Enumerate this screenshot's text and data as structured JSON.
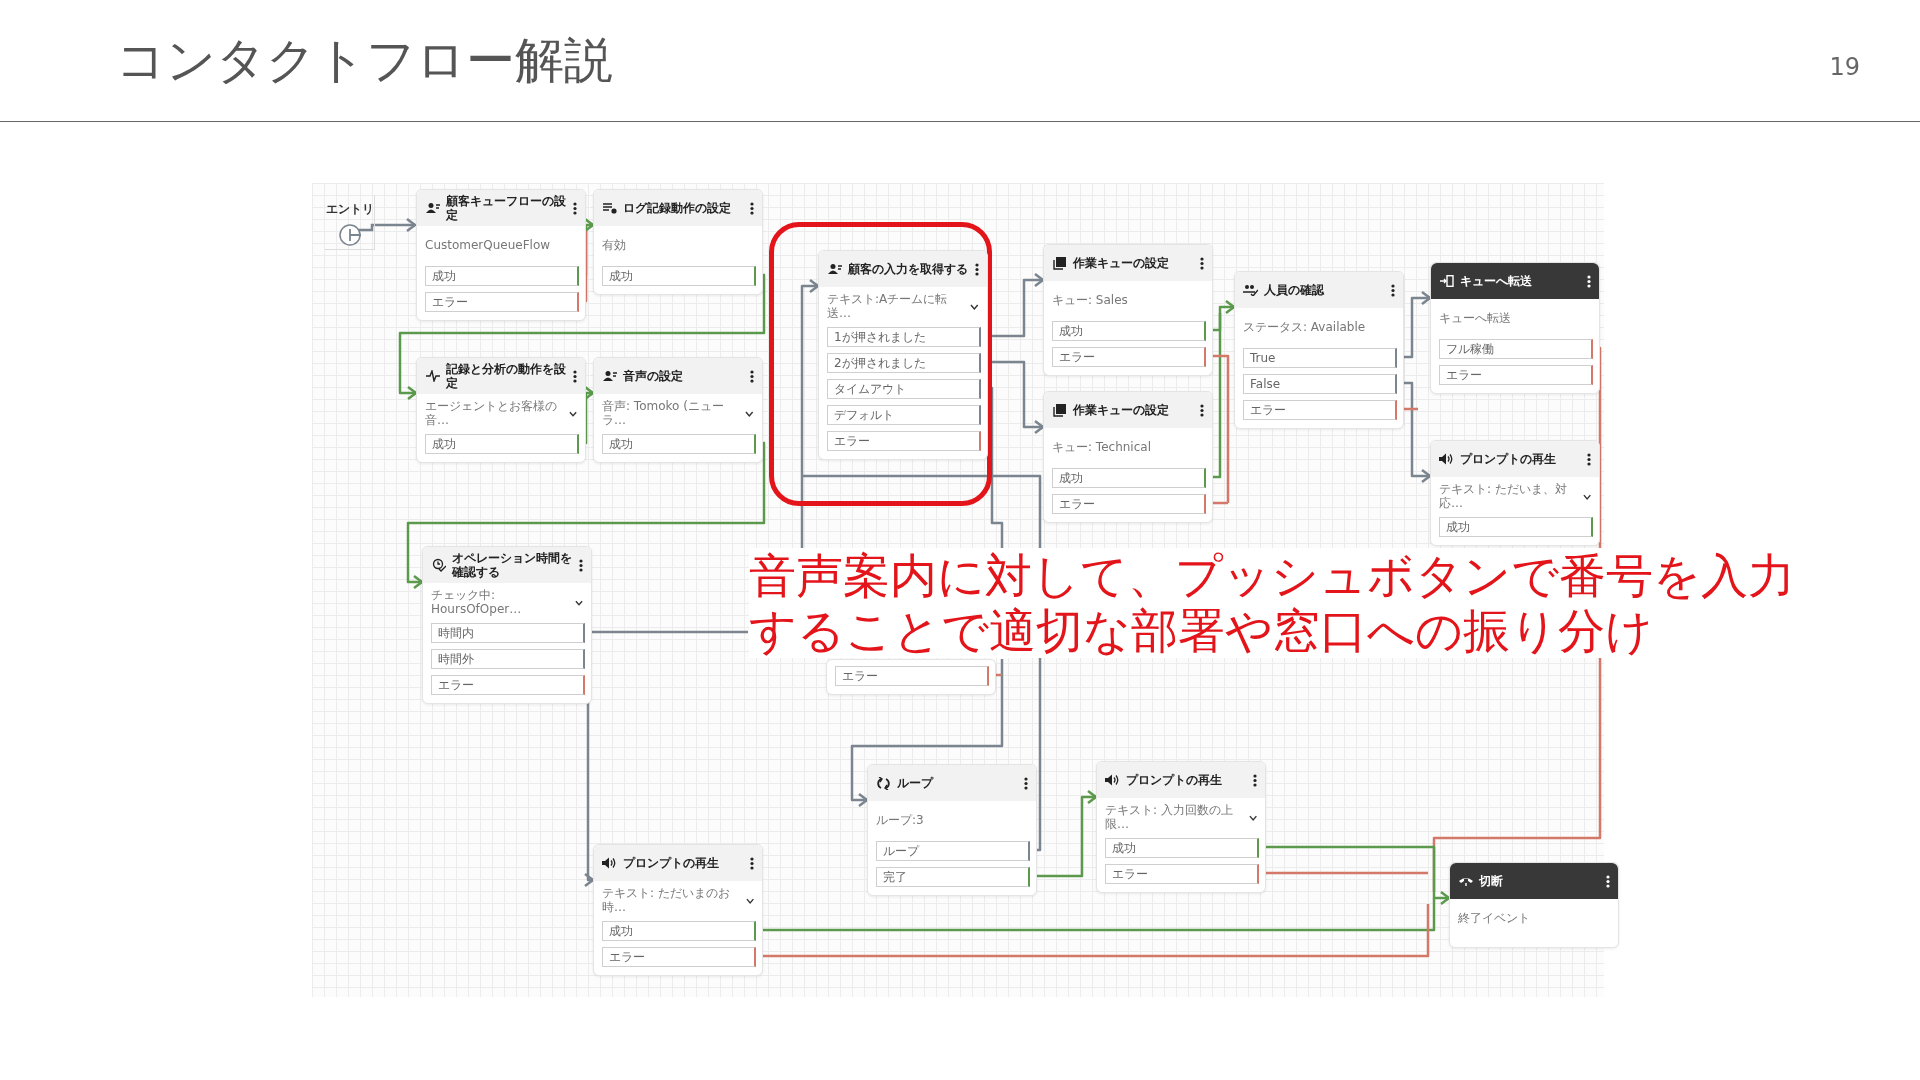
{
  "slide": {
    "title": "コンタクトフロー解説",
    "page_number": "19"
  },
  "flow": {
    "entry": {
      "label": "エントリ"
    },
    "blocks": [
      {
        "title": "顧客キューフローの設定",
        "kind": "action",
        "detail": "CustomerQueueFlow",
        "dropdown": false,
        "ports": [
          {
            "label": "成功",
            "kind": "success"
          },
          {
            "label": "エラー",
            "kind": "error"
          }
        ]
      },
      {
        "title": "ログ記録動作の設定",
        "kind": "action",
        "detail": "有効",
        "dropdown": false,
        "ports": [
          {
            "label": "成功",
            "kind": "success"
          }
        ]
      },
      {
        "title": "記録と分析の動作を設定",
        "kind": "action",
        "detail": "エージェントとお客様の音…",
        "dropdown": true,
        "ports": [
          {
            "label": "成功",
            "kind": "success"
          }
        ]
      },
      {
        "title": "音声の設定",
        "kind": "action",
        "detail": "音声: Tomoko (ニューラ…",
        "dropdown": true,
        "ports": [
          {
            "label": "成功",
            "kind": "success"
          }
        ]
      },
      {
        "title": "顧客の入力を取得する",
        "kind": "action",
        "detail": "テキスト:Aチームに転送…",
        "dropdown": true,
        "ports": [
          {
            "label": "1が押されました",
            "kind": "branch"
          },
          {
            "label": "2が押されました",
            "kind": "branch"
          },
          {
            "label": "タイムアウト",
            "kind": "branch"
          },
          {
            "label": "デフォルト",
            "kind": "branch"
          },
          {
            "label": "エラー",
            "kind": "error"
          }
        ]
      },
      {
        "title": "作業キューの設定",
        "kind": "action",
        "detail": "キュー: Sales",
        "dropdown": false,
        "ports": [
          {
            "label": "成功",
            "kind": "success"
          },
          {
            "label": "エラー",
            "kind": "error"
          }
        ]
      },
      {
        "title": "作業キューの設定",
        "kind": "action",
        "detail": "キュー: Technical",
        "dropdown": false,
        "ports": [
          {
            "label": "成功",
            "kind": "success"
          },
          {
            "label": "エラー",
            "kind": "error"
          }
        ]
      },
      {
        "title": "人員の確認",
        "kind": "action",
        "detail": "ステータス: Available",
        "dropdown": false,
        "ports": [
          {
            "label": "True",
            "kind": "branch"
          },
          {
            "label": "False",
            "kind": "branch"
          },
          {
            "label": "エラー",
            "kind": "error"
          }
        ]
      },
      {
        "title": "キューへ転送",
        "kind": "terminal",
        "detail": "キューへ転送",
        "dropdown": false,
        "ports": [
          {
            "label": "フル稼働",
            "kind": "error"
          },
          {
            "label": "エラー",
            "kind": "error"
          }
        ]
      },
      {
        "title": "プロンプトの再生",
        "kind": "action",
        "detail": "テキスト: ただいま、対応…",
        "dropdown": true,
        "ports": [
          {
            "label": "成功",
            "kind": "success"
          }
        ]
      },
      {
        "title": "オペレーション時間を確認する",
        "kind": "action",
        "detail": "チェック中: HoursOfOper…",
        "dropdown": true,
        "ports": [
          {
            "label": "時間内",
            "kind": "branch"
          },
          {
            "label": "時間外",
            "kind": "branch"
          },
          {
            "label": "エラー",
            "kind": "error"
          }
        ]
      },
      {
        "kind": "partial",
        "ports": [
          {
            "label": "エラー",
            "kind": "error"
          }
        ]
      },
      {
        "title": "ループ",
        "kind": "action",
        "detail": "ループ:3",
        "dropdown": false,
        "ports": [
          {
            "label": "ループ",
            "kind": "branch"
          },
          {
            "label": "完了",
            "kind": "success"
          }
        ]
      },
      {
        "title": "プロンプトの再生",
        "kind": "action",
        "detail": "テキスト: ただいまのお時…",
        "dropdown": true,
        "ports": [
          {
            "label": "成功",
            "kind": "success"
          },
          {
            "label": "エラー",
            "kind": "error"
          }
        ]
      },
      {
        "title": "プロンプトの再生",
        "kind": "action",
        "detail": "テキスト: 入力回数の上限…",
        "dropdown": true,
        "ports": [
          {
            "label": "成功",
            "kind": "success"
          },
          {
            "label": "エラー",
            "kind": "error"
          }
        ]
      },
      {
        "title": "切断",
        "kind": "terminal",
        "detail": "終了イベント",
        "dropdown": false
      }
    ]
  },
  "annotation": {
    "text": "音声案内に対して、プッシュボタンで番号を入力することで適切な部署や窓口への振り分け"
  }
}
